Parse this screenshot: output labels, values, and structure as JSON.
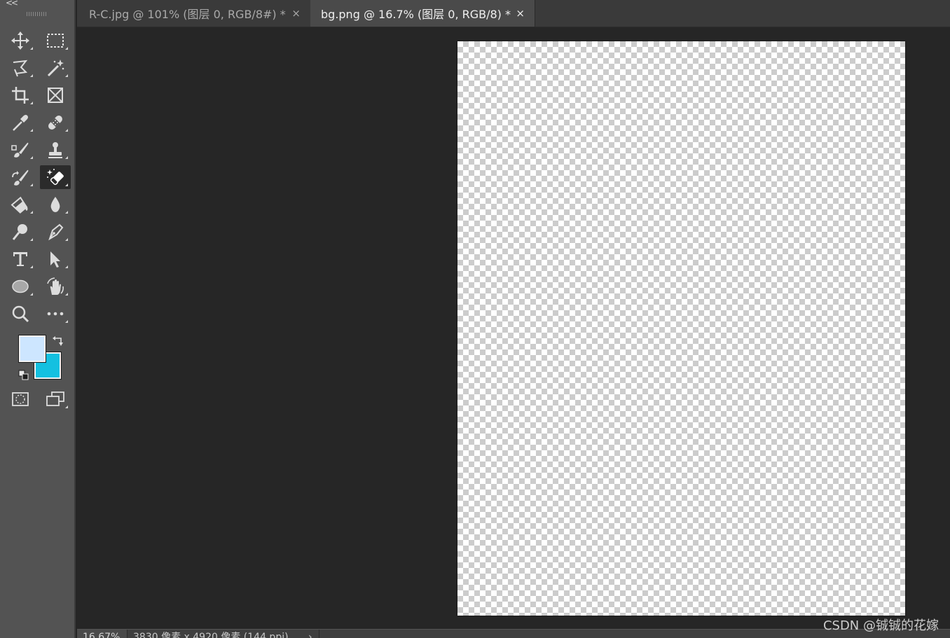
{
  "toolbar": {
    "collapse_label": "<<",
    "tools": [
      {
        "name": "move-tool",
        "icon": "move-icon"
      },
      {
        "name": "marquee-tool",
        "icon": "rect-marquee-icon"
      },
      {
        "name": "lasso-tool",
        "icon": "polygon-lasso-icon"
      },
      {
        "name": "magic-wand-tool",
        "icon": "magic-wand-icon"
      },
      {
        "name": "crop-tool",
        "icon": "crop-icon"
      },
      {
        "name": "frame-tool",
        "icon": "frame-icon"
      },
      {
        "name": "eyedropper-tool",
        "icon": "eyedropper-icon"
      },
      {
        "name": "healing-brush-tool",
        "icon": "bandage-icon"
      },
      {
        "name": "brush-tool",
        "icon": "brush-icon"
      },
      {
        "name": "stamp-tool",
        "icon": "stamp-icon"
      },
      {
        "name": "history-brush-tool",
        "icon": "history-brush-icon"
      },
      {
        "name": "magic-eraser-tool",
        "icon": "magic-eraser-icon",
        "active": true
      },
      {
        "name": "paint-bucket-tool",
        "icon": "paint-bucket-icon"
      },
      {
        "name": "blur-tool",
        "icon": "drop-icon"
      },
      {
        "name": "dodge-tool",
        "icon": "dodge-icon"
      },
      {
        "name": "pen-tool",
        "icon": "pen-icon"
      },
      {
        "name": "type-tool",
        "icon": "type-icon"
      },
      {
        "name": "path-selection-tool",
        "icon": "arrow-cursor-icon"
      },
      {
        "name": "ellipse-tool",
        "icon": "ellipse-icon"
      },
      {
        "name": "rotate-view-tool",
        "icon": "hand-rotate-icon"
      },
      {
        "name": "zoom-tool",
        "icon": "zoom-icon"
      },
      {
        "name": "edit-toolbar",
        "icon": "more-icon"
      },
      {
        "name": "quick-mask-button",
        "icon": "quick-mask-icon"
      },
      {
        "name": "screen-mode-button",
        "icon": "screen-mode-icon"
      }
    ],
    "foreground_color": "#cde6ff",
    "background_color": "#14c0e0"
  },
  "tabs": [
    {
      "title": "R-C.jpg @ 101% (图层 0, RGB/8#) *",
      "close": "×",
      "active": false
    },
    {
      "title": "bg.png @ 16.7% (图层 0, RGB/8) *",
      "close": "×",
      "active": true
    }
  ],
  "statusbar": {
    "zoom": "16.67%",
    "doc_info": "3830 像素 x 4920 像素 (144 ppi)",
    "arrow": "›"
  },
  "watermark": "CSDN @铖铖的花嫁",
  "colors": {
    "workspace": "#262626",
    "toolbar": "#535353",
    "active_tab": "#4a4a4a",
    "inactive_tab": "#3a3a3a"
  }
}
